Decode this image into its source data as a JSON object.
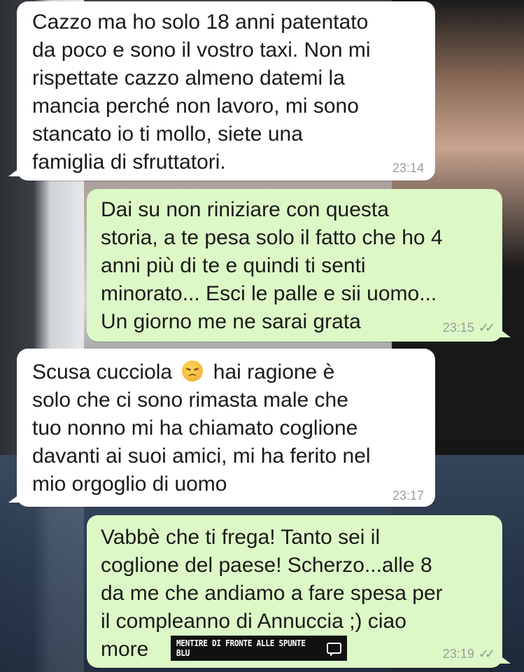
{
  "messages": [
    {
      "direction": "incoming",
      "text": "Cazzo ma ho solo 18 anni patentato\nda poco e sono il vostro taxi. Non mi\nrispettate cazzo almeno datemi la\nmancia perché non lavoro, mi sono\nstancato io ti mollo, siete una\nfamiglia di sfruttatori.",
      "time": "23:14"
    },
    {
      "direction": "outgoing",
      "text": "Dai su non riniziare con questa\nstoria, a te pesa solo il fatto che ho 4\nanni più di te e quindi ti senti\nminorato... Esci le palle e sii uomo...\nUn giorno me ne sarai grata",
      "time": "23:15",
      "ticks": "✓✓"
    },
    {
      "direction": "incoming",
      "text_before_emoji": "Scusa cucciola",
      "emoji": "disappointed-face",
      "text_after_emoji": "hai ragione è",
      "text_rest": "solo che ci sono rimasta male che\ntuo nonno mi ha chiamato coglione\ndavanti ai suoi amici, mi ha ferito nel\nmio orgoglio di uomo",
      "time": "23:17"
    },
    {
      "direction": "outgoing",
      "text": "Vabbè che ti frega! Tanto sei il\ncoglione del paese! Scherzo...alle 8\nda me che andiamo a fare spesa per\nil compleanno di Annuccia ;) ciao\nmore",
      "time": "23:19",
      "ticks": "✓✓"
    }
  ],
  "watermark": {
    "text": "MENTIRE DI FRONTE ALLE SPUNTE BLU",
    "icon": "chat-bubble-icon"
  },
  "colors": {
    "incoming_bubble": "#ffffff",
    "outgoing_bubble": "#dcf8c6",
    "timestamp": "#9aa09a"
  }
}
